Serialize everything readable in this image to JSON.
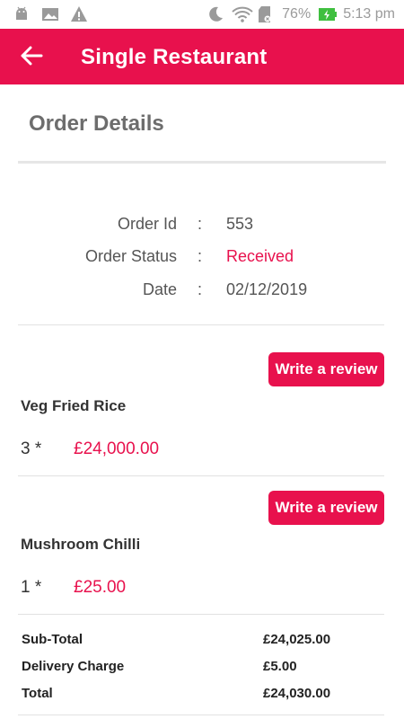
{
  "status_bar": {
    "battery": "76%",
    "time": "5:13 pm",
    "icons": [
      "android-icon",
      "image-icon",
      "warning-icon",
      "moon-icon",
      "wifi-icon",
      "sd-card-icon",
      "battery-charging-icon"
    ]
  },
  "app_bar": {
    "title": "Single Restaurant",
    "back_icon": "arrow-left-icon"
  },
  "order_details": {
    "title": "Order Details",
    "rows": [
      {
        "label": "Order Id",
        "colon": ":",
        "value": "553"
      },
      {
        "label": "Order Status",
        "colon": ":",
        "value": "Received"
      },
      {
        "label": "Date",
        "colon": ":",
        "value": "02/12/2019"
      }
    ]
  },
  "items": [
    {
      "review_label": "Write a review",
      "name": "Veg Fried Rice",
      "qty": "3 *",
      "price": "£24,000.00"
    },
    {
      "review_label": "Write a review",
      "name": "Mushroom Chilli",
      "qty": "1 *",
      "price": "£25.00"
    }
  ],
  "summary": [
    {
      "label": "Sub-Total",
      "value": "£24,025.00"
    },
    {
      "label": "Delivery Charge",
      "value": "£5.00"
    },
    {
      "label": "Total",
      "value": "£24,030.00"
    }
  ],
  "colors": {
    "accent": "#e8114d",
    "status_received": "#e8114d",
    "battery_green": "#3fbf3f"
  }
}
